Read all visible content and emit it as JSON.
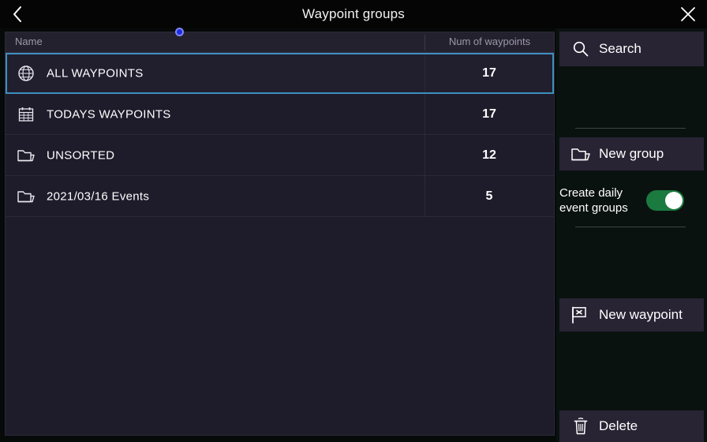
{
  "header": {
    "title": "Waypoint groups",
    "back_icon": "chevron-left-icon",
    "close_icon": "close-icon"
  },
  "table": {
    "columns": [
      {
        "key": "name",
        "label": "Name"
      },
      {
        "key": "num",
        "label": "Num of waypoints"
      }
    ],
    "rows": [
      {
        "icon": "globe-icon",
        "name": "ALL WAYPOINTS",
        "num": "17",
        "selected": true
      },
      {
        "icon": "calendar-icon",
        "name": "TODAYS WAYPOINTS",
        "num": "17",
        "selected": false
      },
      {
        "icon": "folder-icon",
        "name": "UNSORTED",
        "num": "12",
        "selected": false
      },
      {
        "icon": "folder-icon",
        "name": "2021/03/16 Events",
        "num": "5",
        "selected": false
      }
    ]
  },
  "sidebar": {
    "search": {
      "label": "Search",
      "icon": "search-icon"
    },
    "new_group": {
      "label": "New group",
      "icon": "folder-icon"
    },
    "daily_toggle": {
      "label": "Create daily event groups",
      "state": "on"
    },
    "new_waypoint": {
      "label": "New waypoint",
      "icon": "flag-waypoint-icon"
    },
    "delete": {
      "label": "Delete",
      "icon": "trash-icon"
    }
  },
  "colors": {
    "background": "#060a08",
    "header_bg": "#050505",
    "list_bg": "#1e1b2a",
    "sidebar_bg": "#0a1210",
    "button_bg": "#282434",
    "selection_border": "#3d8fc0",
    "toggle_on": "#1b7a3f",
    "cursor_dot": "#1d2ce0",
    "text_primary": "#ffffff",
    "text_muted": "#9b97a8"
  }
}
